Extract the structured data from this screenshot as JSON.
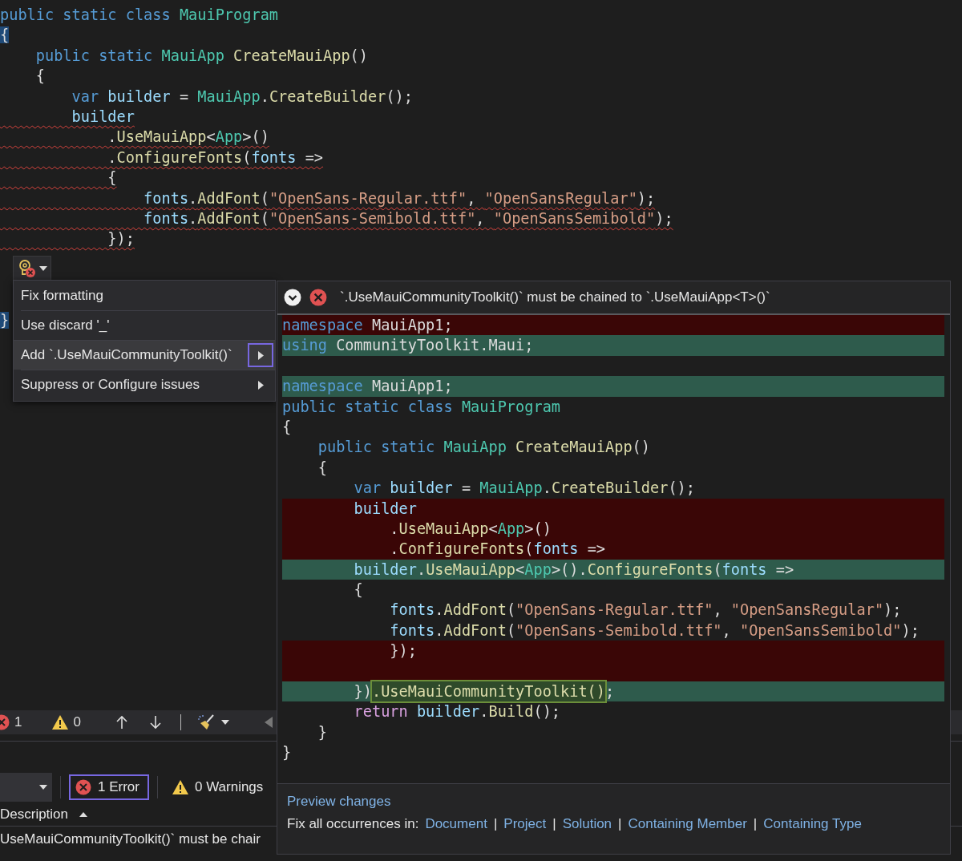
{
  "editor": {
    "lines": [
      {
        "tokens": [
          {
            "kind": "keyword",
            "text": "public static class "
          },
          {
            "kind": "type",
            "text": "MauiProgram"
          }
        ]
      },
      {
        "tokens": [
          {
            "kind": "plain",
            "text": "{",
            "match": true
          }
        ]
      },
      {
        "tokens": [
          {
            "kind": "keyword",
            "text": "    public static "
          },
          {
            "kind": "type",
            "text": "MauiApp "
          },
          {
            "kind": "method",
            "text": "CreateMauiApp"
          },
          {
            "kind": "plain",
            "text": "()"
          }
        ]
      },
      {
        "tokens": [
          {
            "kind": "plain",
            "text": "    {"
          }
        ]
      },
      {
        "tokens": [
          {
            "kind": "keyword",
            "text": "        var "
          },
          {
            "kind": "variable",
            "text": "builder"
          },
          {
            "kind": "plain",
            "text": " = "
          },
          {
            "kind": "type",
            "text": "MauiApp"
          },
          {
            "kind": "plain",
            "text": "."
          },
          {
            "kind": "method",
            "text": "CreateBuilder"
          },
          {
            "kind": "plain",
            "text": "();"
          }
        ]
      },
      {
        "squiggle": true,
        "tokens": [
          {
            "kind": "variable",
            "text": "        builder"
          }
        ]
      },
      {
        "squiggle": true,
        "tokens": [
          {
            "kind": "plain",
            "text": "            ."
          },
          {
            "kind": "method",
            "text": "UseMauiApp"
          },
          {
            "kind": "plain",
            "text": "<"
          },
          {
            "kind": "type",
            "text": "App"
          },
          {
            "kind": "plain",
            "text": ">()"
          }
        ]
      },
      {
        "squiggle": true,
        "tokens": [
          {
            "kind": "plain",
            "text": "            ."
          },
          {
            "kind": "method",
            "text": "ConfigureFonts"
          },
          {
            "kind": "plain",
            "text": "("
          },
          {
            "kind": "variable",
            "text": "fonts"
          },
          {
            "kind": "plain",
            "text": " =>"
          }
        ]
      },
      {
        "squiggle": true,
        "tokens": [
          {
            "kind": "plain",
            "text": "            {"
          }
        ]
      },
      {
        "squiggle": true,
        "tokens": [
          {
            "kind": "variable",
            "text": "                fonts"
          },
          {
            "kind": "plain",
            "text": "."
          },
          {
            "kind": "method",
            "text": "AddFont"
          },
          {
            "kind": "plain",
            "text": "("
          },
          {
            "kind": "string",
            "text": "\"OpenSans-Regular.ttf\""
          },
          {
            "kind": "plain",
            "text": ", "
          },
          {
            "kind": "string",
            "text": "\"OpenSansRegular\""
          },
          {
            "kind": "plain",
            "text": ");"
          }
        ]
      },
      {
        "squiggle": true,
        "tokens": [
          {
            "kind": "variable",
            "text": "                fonts"
          },
          {
            "kind": "plain",
            "text": "."
          },
          {
            "kind": "method",
            "text": "AddFont"
          },
          {
            "kind": "plain",
            "text": "("
          },
          {
            "kind": "string",
            "text": "\"OpenSans-Semibold.ttf\""
          },
          {
            "kind": "plain",
            "text": ", "
          },
          {
            "kind": "string",
            "text": "\"OpenSansSemibold\""
          },
          {
            "kind": "plain",
            "text": ");"
          }
        ]
      },
      {
        "squiggle": true,
        "tokens": [
          {
            "kind": "plain",
            "text": "            });"
          }
        ]
      },
      {
        "kind": "lightbulb"
      },
      {
        "tokens": [
          {
            "kind": "plain",
            "text": "}",
            "match": true
          }
        ]
      }
    ]
  },
  "quick_actions": {
    "items": [
      {
        "label": "Fix formatting",
        "selected": false,
        "submenu": false
      },
      {
        "label": "Use discard '_'",
        "selected": false,
        "submenu": false
      },
      {
        "label": "Add `.UseMauiCommunityToolkit()`",
        "selected": true,
        "submenu": true
      },
      {
        "label": "Suppress or Configure issues",
        "selected": false,
        "submenu": true
      }
    ]
  },
  "preview": {
    "message": "`.UseMauiCommunityToolkit()` must be chained to `.UseMauiApp<T>()`",
    "lines": [
      {
        "kind": "removed",
        "tokens": [
          {
            "kind": "keyword",
            "text": "namespace "
          },
          {
            "kind": "plain",
            "text": "MauiApp1;"
          }
        ]
      },
      {
        "kind": "added",
        "tokens": [
          {
            "kind": "keyword",
            "text": "using "
          },
          {
            "kind": "plain",
            "text": "CommunityToolkit.Maui;"
          }
        ]
      },
      {
        "kind": "unchanged"
      },
      {
        "kind": "added",
        "tokens": [
          {
            "kind": "keyword",
            "text": "namespace "
          },
          {
            "kind": "plain",
            "text": "MauiApp1;"
          }
        ]
      },
      {
        "kind": "unchanged",
        "tokens": [
          {
            "kind": "keyword",
            "text": "public static class "
          },
          {
            "kind": "type",
            "text": "MauiProgram"
          }
        ]
      },
      {
        "kind": "unchanged",
        "tokens": [
          {
            "kind": "plain",
            "text": "{"
          }
        ]
      },
      {
        "kind": "unchanged",
        "tokens": [
          {
            "kind": "keyword",
            "text": "    public static "
          },
          {
            "kind": "type",
            "text": "MauiApp "
          },
          {
            "kind": "method",
            "text": "CreateMauiApp"
          },
          {
            "kind": "plain",
            "text": "()"
          }
        ]
      },
      {
        "kind": "unchanged",
        "tokens": [
          {
            "kind": "plain",
            "text": "    {"
          }
        ]
      },
      {
        "kind": "unchanged",
        "tokens": [
          {
            "kind": "keyword",
            "text": "        var "
          },
          {
            "kind": "variable",
            "text": "builder"
          },
          {
            "kind": "plain",
            "text": " = "
          },
          {
            "kind": "type",
            "text": "MauiApp"
          },
          {
            "kind": "plain",
            "text": "."
          },
          {
            "kind": "method",
            "text": "CreateBuilder"
          },
          {
            "kind": "plain",
            "text": "();"
          }
        ]
      },
      {
        "kind": "removed",
        "tokens": [
          {
            "kind": "variable",
            "text": "        builder"
          }
        ]
      },
      {
        "kind": "removed",
        "tokens": [
          {
            "kind": "plain",
            "text": "            ."
          },
          {
            "kind": "method",
            "text": "UseMauiApp"
          },
          {
            "kind": "plain",
            "text": "<"
          },
          {
            "kind": "type",
            "text": "App"
          },
          {
            "kind": "plain",
            "text": ">()"
          }
        ]
      },
      {
        "kind": "removed",
        "tokens": [
          {
            "kind": "plain",
            "text": "            ."
          },
          {
            "kind": "method",
            "text": "ConfigureFonts"
          },
          {
            "kind": "plain",
            "text": "("
          },
          {
            "kind": "variable",
            "text": "fonts"
          },
          {
            "kind": "plain",
            "text": " =>"
          }
        ]
      },
      {
        "kind": "added",
        "tokens": [
          {
            "kind": "variable",
            "text": "        builder"
          },
          {
            "kind": "plain",
            "text": "."
          },
          {
            "kind": "method",
            "text": "UseMauiApp"
          },
          {
            "kind": "plain",
            "text": "<"
          },
          {
            "kind": "type",
            "text": "App"
          },
          {
            "kind": "plain",
            "text": ">()."
          },
          {
            "kind": "method",
            "text": "ConfigureFonts"
          },
          {
            "kind": "plain",
            "text": "("
          },
          {
            "kind": "variable",
            "text": "fonts"
          },
          {
            "kind": "plain",
            "text": " =>"
          }
        ]
      },
      {
        "kind": "unchanged",
        "tokens": [
          {
            "kind": "plain",
            "text": "        {"
          }
        ]
      },
      {
        "kind": "unchanged",
        "tokens": [
          {
            "kind": "variable",
            "text": "            fonts"
          },
          {
            "kind": "plain",
            "text": "."
          },
          {
            "kind": "method",
            "text": "AddFont"
          },
          {
            "kind": "plain",
            "text": "("
          },
          {
            "kind": "string",
            "text": "\"OpenSans-Regular.ttf\""
          },
          {
            "kind": "plain",
            "text": ", "
          },
          {
            "kind": "string",
            "text": "\"OpenSansRegular\""
          },
          {
            "kind": "plain",
            "text": ");"
          }
        ]
      },
      {
        "kind": "unchanged",
        "tokens": [
          {
            "kind": "variable",
            "text": "            fonts"
          },
          {
            "kind": "plain",
            "text": "."
          },
          {
            "kind": "method",
            "text": "AddFont"
          },
          {
            "kind": "plain",
            "text": "("
          },
          {
            "kind": "string",
            "text": "\"OpenSans-Semibold.ttf\""
          },
          {
            "kind": "plain",
            "text": ", "
          },
          {
            "kind": "string",
            "text": "\"OpenSansSemibold\""
          },
          {
            "kind": "plain",
            "text": ");"
          }
        ]
      },
      {
        "kind": "removed",
        "tokens": [
          {
            "kind": "plain",
            "text": "            });"
          }
        ]
      },
      {
        "kind": "removed"
      },
      {
        "kind": "added",
        "tokens": [
          {
            "kind": "plain",
            "text": "        })"
          },
          {
            "kind": "method",
            "text": ".UseMauiCommunityToolkit()",
            "highlight": true
          },
          {
            "kind": "plain",
            "text": ";"
          }
        ]
      },
      {
        "kind": "unchanged",
        "tokens": [
          {
            "kind": "control",
            "text": "        return "
          },
          {
            "kind": "variable",
            "text": "builder"
          },
          {
            "kind": "plain",
            "text": "."
          },
          {
            "kind": "method",
            "text": "Build"
          },
          {
            "kind": "plain",
            "text": "();"
          }
        ]
      },
      {
        "kind": "unchanged",
        "tokens": [
          {
            "kind": "plain",
            "text": "    }"
          }
        ]
      },
      {
        "kind": "unchanged",
        "tokens": [
          {
            "kind": "plain",
            "text": "}"
          }
        ]
      }
    ],
    "preview_link": "Preview changes",
    "fix_all": {
      "label": "Fix all occurrences in:",
      "separator": "|",
      "links": [
        "Document",
        "Project",
        "Solution",
        "Containing Member",
        "Containing Type"
      ]
    }
  },
  "status_toolbar": {
    "errors": "1",
    "warnings": "0"
  },
  "error_list": {
    "error_filter": {
      "label": "1 Error",
      "selected": true
    },
    "warning_filter": {
      "label": "0 Warnings",
      "selected": false
    },
    "column": "Description",
    "row": "UseMauiCommunityToolkit()` must be chair"
  }
}
